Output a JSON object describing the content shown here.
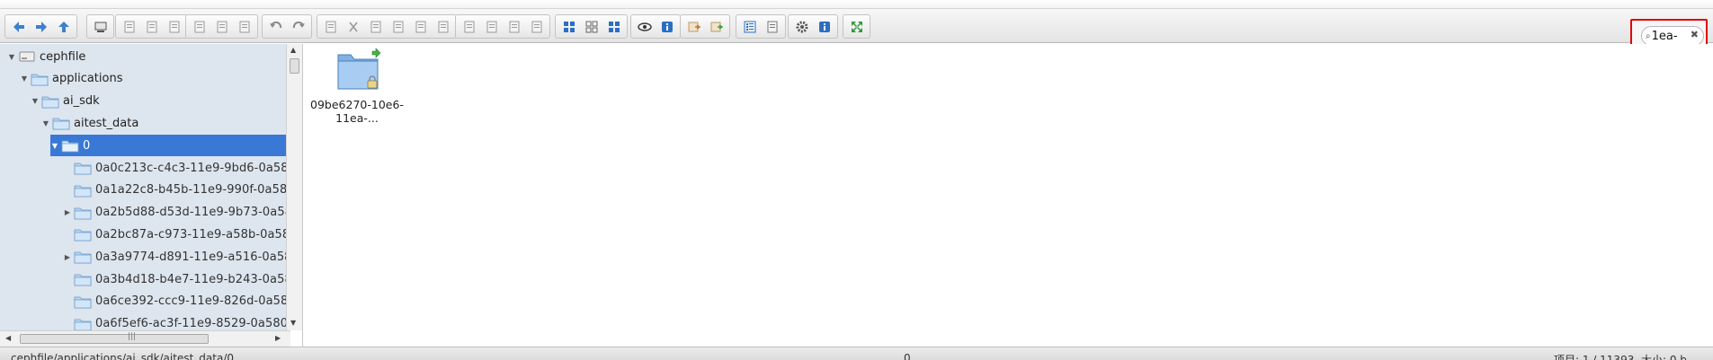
{
  "toolbar": {
    "groups": [
      {
        "name": "navigation",
        "buttons": [
          "back-icon",
          "forward-icon",
          "up-icon"
        ]
      },
      {
        "name": "computer",
        "buttons": [
          "computer-icon"
        ]
      },
      {
        "name": "file",
        "buttons": [
          "new-file-icon",
          "open-icon",
          "save-icon"
        ]
      },
      {
        "name": "view-file",
        "buttons": [
          "preview-icon",
          "disk-icon",
          "select-icon"
        ]
      },
      {
        "name": "history",
        "buttons": [
          "undo-icon",
          "redo-icon"
        ]
      },
      {
        "name": "edit",
        "buttons": [
          "copy-icon",
          "cut-icon",
          "paste-icon",
          "duplicate-icon",
          "rename-icon",
          "edit-icon"
        ]
      },
      {
        "name": "tools",
        "buttons": [
          "refresh-icon",
          "select-all-icon",
          "info-icon",
          "settings-wheel-icon"
        ]
      },
      {
        "name": "view",
        "buttons": [
          "icons-view-icon",
          "small-icons-view-icon",
          "large-icons-view-icon"
        ]
      },
      {
        "name": "visibility",
        "buttons": [
          "eye-icon",
          "info-panel-icon"
        ]
      },
      {
        "name": "extract",
        "buttons": [
          "extract-icon",
          "archive-icon"
        ]
      },
      {
        "name": "list",
        "buttons": [
          "list-view-icon",
          "sort-icon"
        ]
      },
      {
        "name": "config",
        "buttons": [
          "gear-icon",
          "help-icon"
        ]
      },
      {
        "name": "fullscreen",
        "buttons": [
          "fullscreen-icon"
        ]
      }
    ],
    "search_text": "1ea-"
  },
  "tree": {
    "items": [
      {
        "label": "cephfile",
        "arrow": "▼",
        "icon": "drive-icon"
      },
      {
        "label": "applications",
        "arrow": "▼",
        "icon": "folder-icon"
      },
      {
        "label": "ai_sdk",
        "arrow": "▼",
        "icon": "folder-icon"
      },
      {
        "label": "aitest_data",
        "arrow": "▼",
        "icon": "folder-icon"
      },
      {
        "label": "0",
        "arrow": "▼",
        "icon": "folder-open-icon",
        "selected": true
      },
      {
        "label": "0a0c213c-c4c3-11e9-9bd6-0a58",
        "arrow": "",
        "icon": "folder-icon"
      },
      {
        "label": "0a1a22c8-b45b-11e9-990f-0a58",
        "arrow": "",
        "icon": "folder-icon"
      },
      {
        "label": "0a2b5d88-d53d-11e9-9b73-0a58",
        "arrow": "▶",
        "icon": "folder-icon"
      },
      {
        "label": "0a2bc87a-c973-11e9-a58b-0a58",
        "arrow": "",
        "icon": "folder-icon"
      },
      {
        "label": "0a3a9774-d891-11e9-a516-0a58",
        "arrow": "▶",
        "icon": "folder-icon"
      },
      {
        "label": "0a3b4d18-b4e7-11e9-b243-0a58",
        "arrow": "",
        "icon": "folder-icon"
      },
      {
        "label": "0a6ce392-ccc9-11e9-826d-0a58",
        "arrow": "",
        "icon": "folder-icon"
      },
      {
        "label": "0a6f5ef6-ac3f-11e9-8529-0a580",
        "arrow": "",
        "icon": "folder-icon"
      }
    ]
  },
  "content": {
    "items": [
      {
        "name": "09be6270-10e6-11ea-...",
        "icon": "folder-shared-icon"
      }
    ]
  },
  "status": {
    "path": "cephfile/applications/ai_sdk/aitest_data/0",
    "selected_count": "0",
    "summary": "项目: 1 / 11393, 大小: 0 b"
  },
  "colors": {
    "selected_row": "#3a78d5",
    "sidebar_bg": "#dde5ee",
    "search_highlight": "#e00000"
  }
}
